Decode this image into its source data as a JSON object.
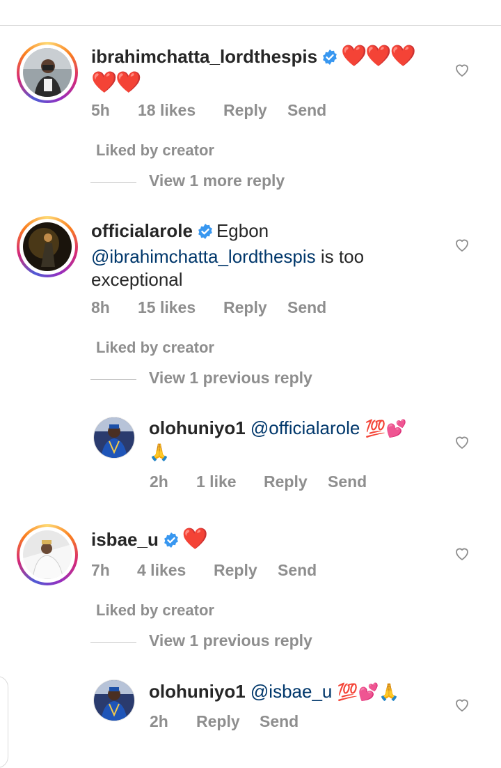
{
  "comments": [
    {
      "username": "ibrahimchatta_lordthespis",
      "verified": true,
      "text_line1": "❤️❤️❤️",
      "text_line2": "❤️❤️",
      "time": "5h",
      "likes": "18 likes",
      "reply": "Reply",
      "send": "Send",
      "liked_by": "Liked by creator",
      "view_replies": "View 1 more reply"
    },
    {
      "username": "officialarole",
      "verified": true,
      "text_start": "Egbon",
      "mention": "@ibrahimchatta_lordthespis",
      "text_after_mention": " is too",
      "text_line3": "exceptional",
      "time": "8h",
      "likes": "15 likes",
      "reply": "Reply",
      "send": "Send",
      "liked_by": "Liked by creator",
      "view_replies": "View 1 previous reply"
    },
    {
      "username": "olohuniyo1",
      "mention": "@officialarole",
      "emoji_after": "💯💕",
      "emoji_line2": "🙏",
      "time": "2h",
      "likes": "1 like",
      "reply": "Reply",
      "send": "Send"
    },
    {
      "username": "isbae_u",
      "verified": true,
      "text": "❤️",
      "time": "7h",
      "likes": "4 likes",
      "reply": "Reply",
      "send": "Send",
      "liked_by": "Liked by creator",
      "view_replies": "View 1 previous reply"
    },
    {
      "username": "olohuniyo1",
      "mention": "@isbae_u",
      "emoji_after": "💯💕🙏",
      "time": "2h",
      "reply": "Reply",
      "send": "Send"
    }
  ],
  "colors": {
    "verified_blue": "#3897f0",
    "mention_blue": "#00376b",
    "meta_gray": "#8e8e8e"
  }
}
